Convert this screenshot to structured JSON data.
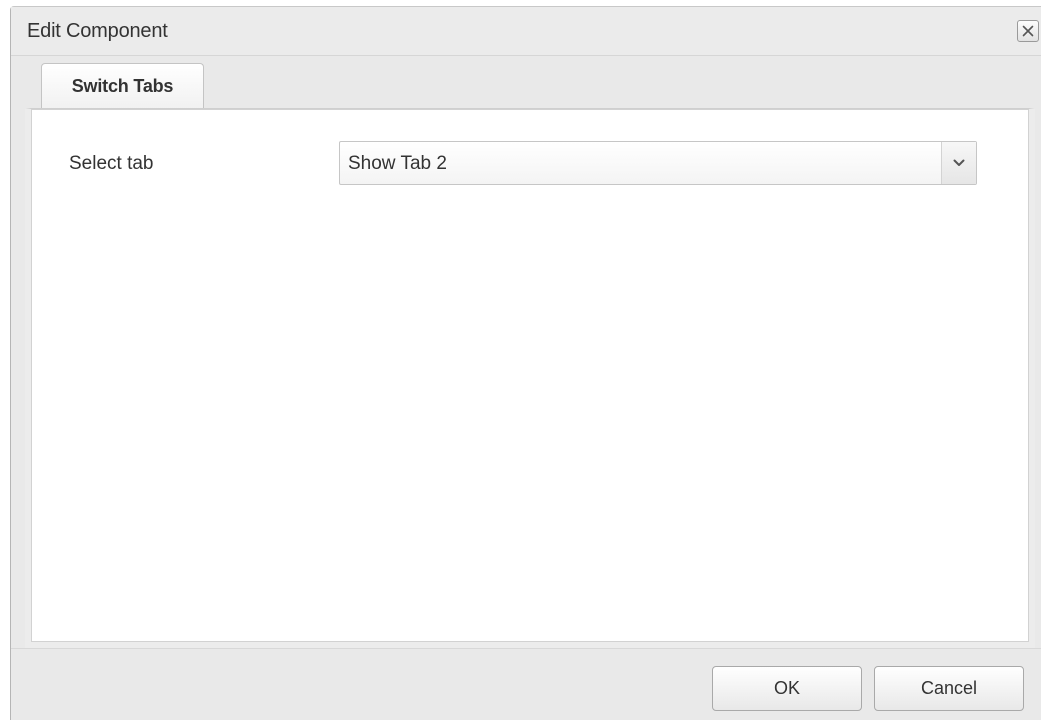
{
  "dialog": {
    "title": "Edit Component",
    "close_icon": "close-icon"
  },
  "tabs": [
    {
      "label": "Switch Tabs"
    }
  ],
  "form": {
    "select_tab": {
      "label": "Select tab",
      "value": "Show Tab 2",
      "arrow_icon": "chevron-down-icon"
    }
  },
  "footer": {
    "ok_label": "OK",
    "cancel_label": "Cancel"
  }
}
